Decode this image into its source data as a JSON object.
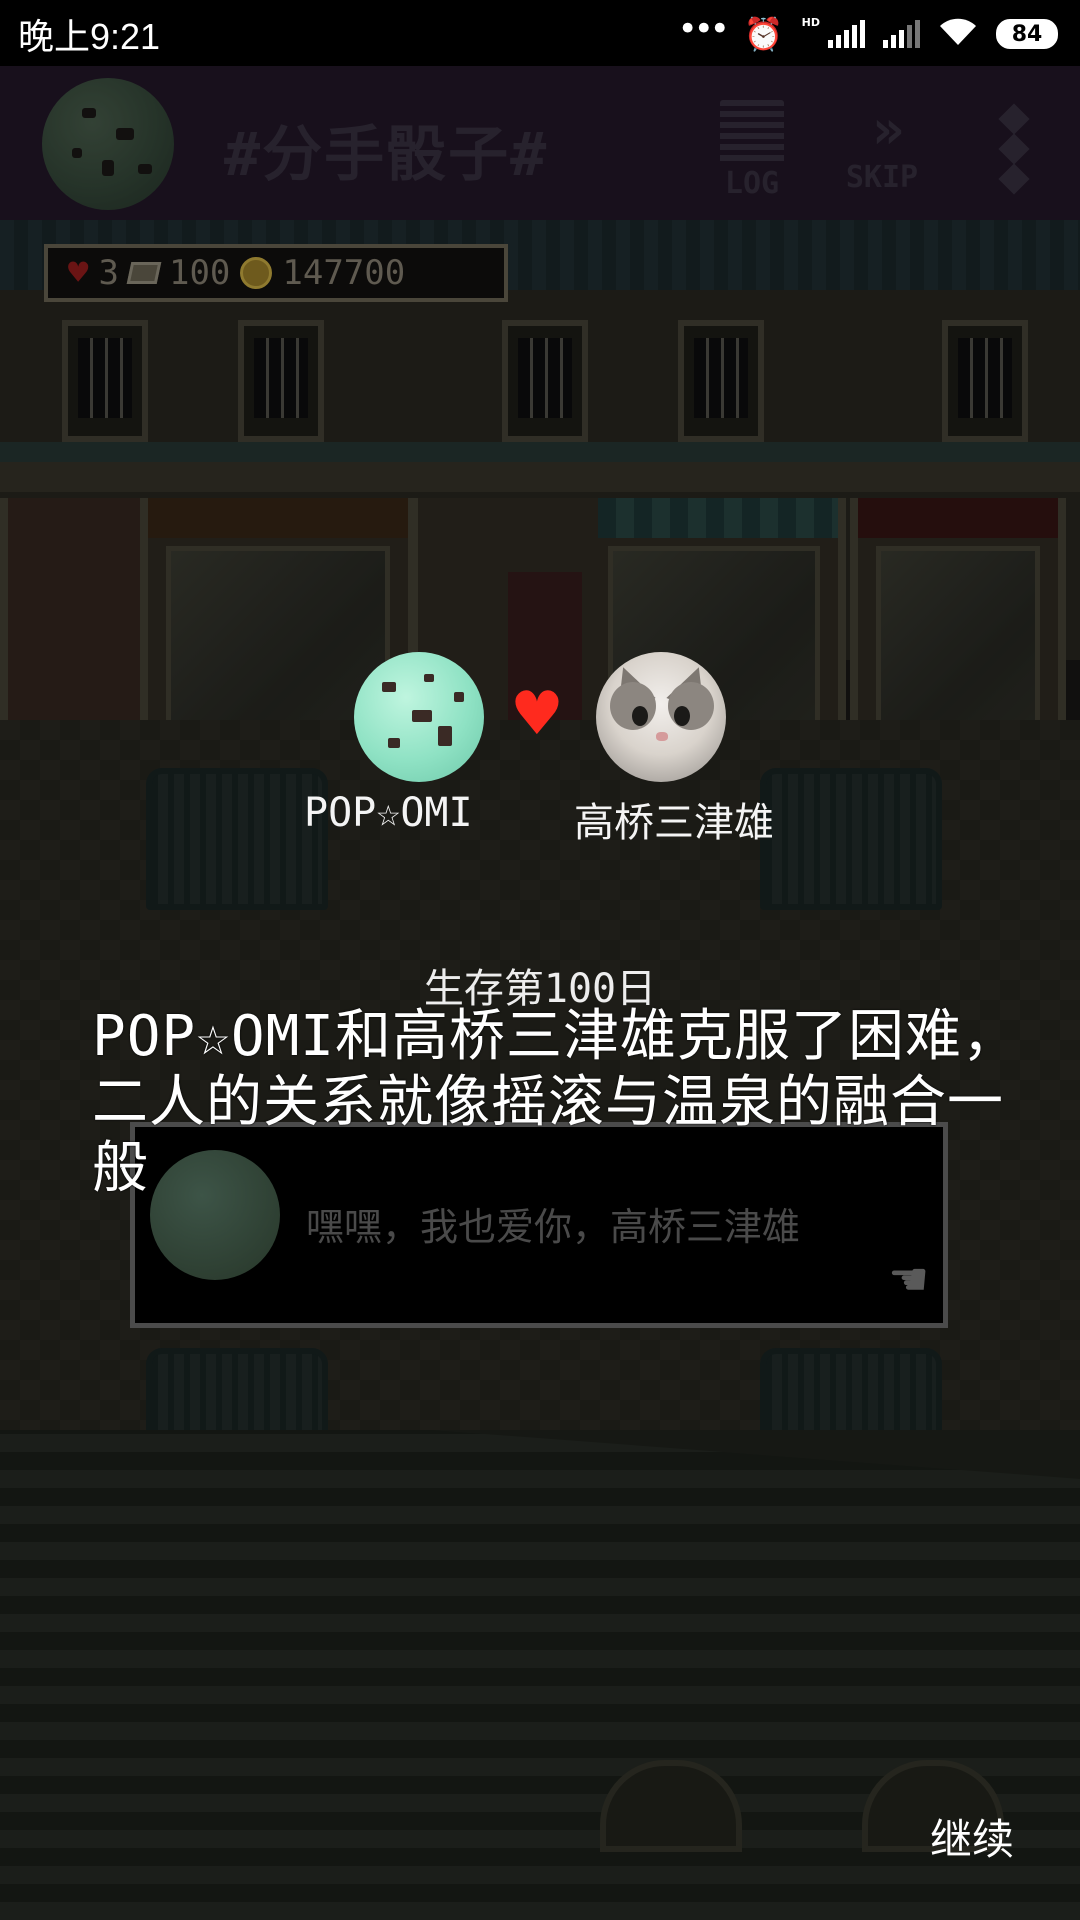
{
  "status_bar": {
    "time": "晚上9:21",
    "network_badge": "HD",
    "battery": "84",
    "icons": [
      "more-dots-icon",
      "alarm-icon",
      "signal-icon",
      "signal-icon",
      "wifi-icon",
      "battery-icon"
    ]
  },
  "top_bar": {
    "title": "#分手骰子#",
    "log_label": "LOG",
    "skip_label": "SKIP",
    "icons": [
      "mint-chip-avatar",
      "log-icon",
      "skip-icon",
      "menu-icon"
    ]
  },
  "hud": {
    "hearts": "3",
    "cards": "100",
    "coins": "147700",
    "icons": [
      "heart-icon",
      "card-icon",
      "coin-icon"
    ]
  },
  "dialogue": {
    "text": "嘿嘿，我也爱你，高桥三津雄",
    "icons": [
      "pointer-hand-icon"
    ]
  },
  "pair": {
    "left_name": "POP☆OMI",
    "right_name": "高桥三津雄",
    "icons": [
      "mint-chip-avatar",
      "heart-icon",
      "cat-avatar"
    ]
  },
  "event": {
    "day": "生存第100日",
    "message": "POP☆OMI和高桥三津雄克服了困难，二人的关系就像摇滚与温泉的融合一般"
  },
  "continue_label": "继续",
  "colors": {
    "top_bar_bg": "#261a2c",
    "heart_red": "#ff2a1e",
    "mint": "#8fe2c4"
  }
}
